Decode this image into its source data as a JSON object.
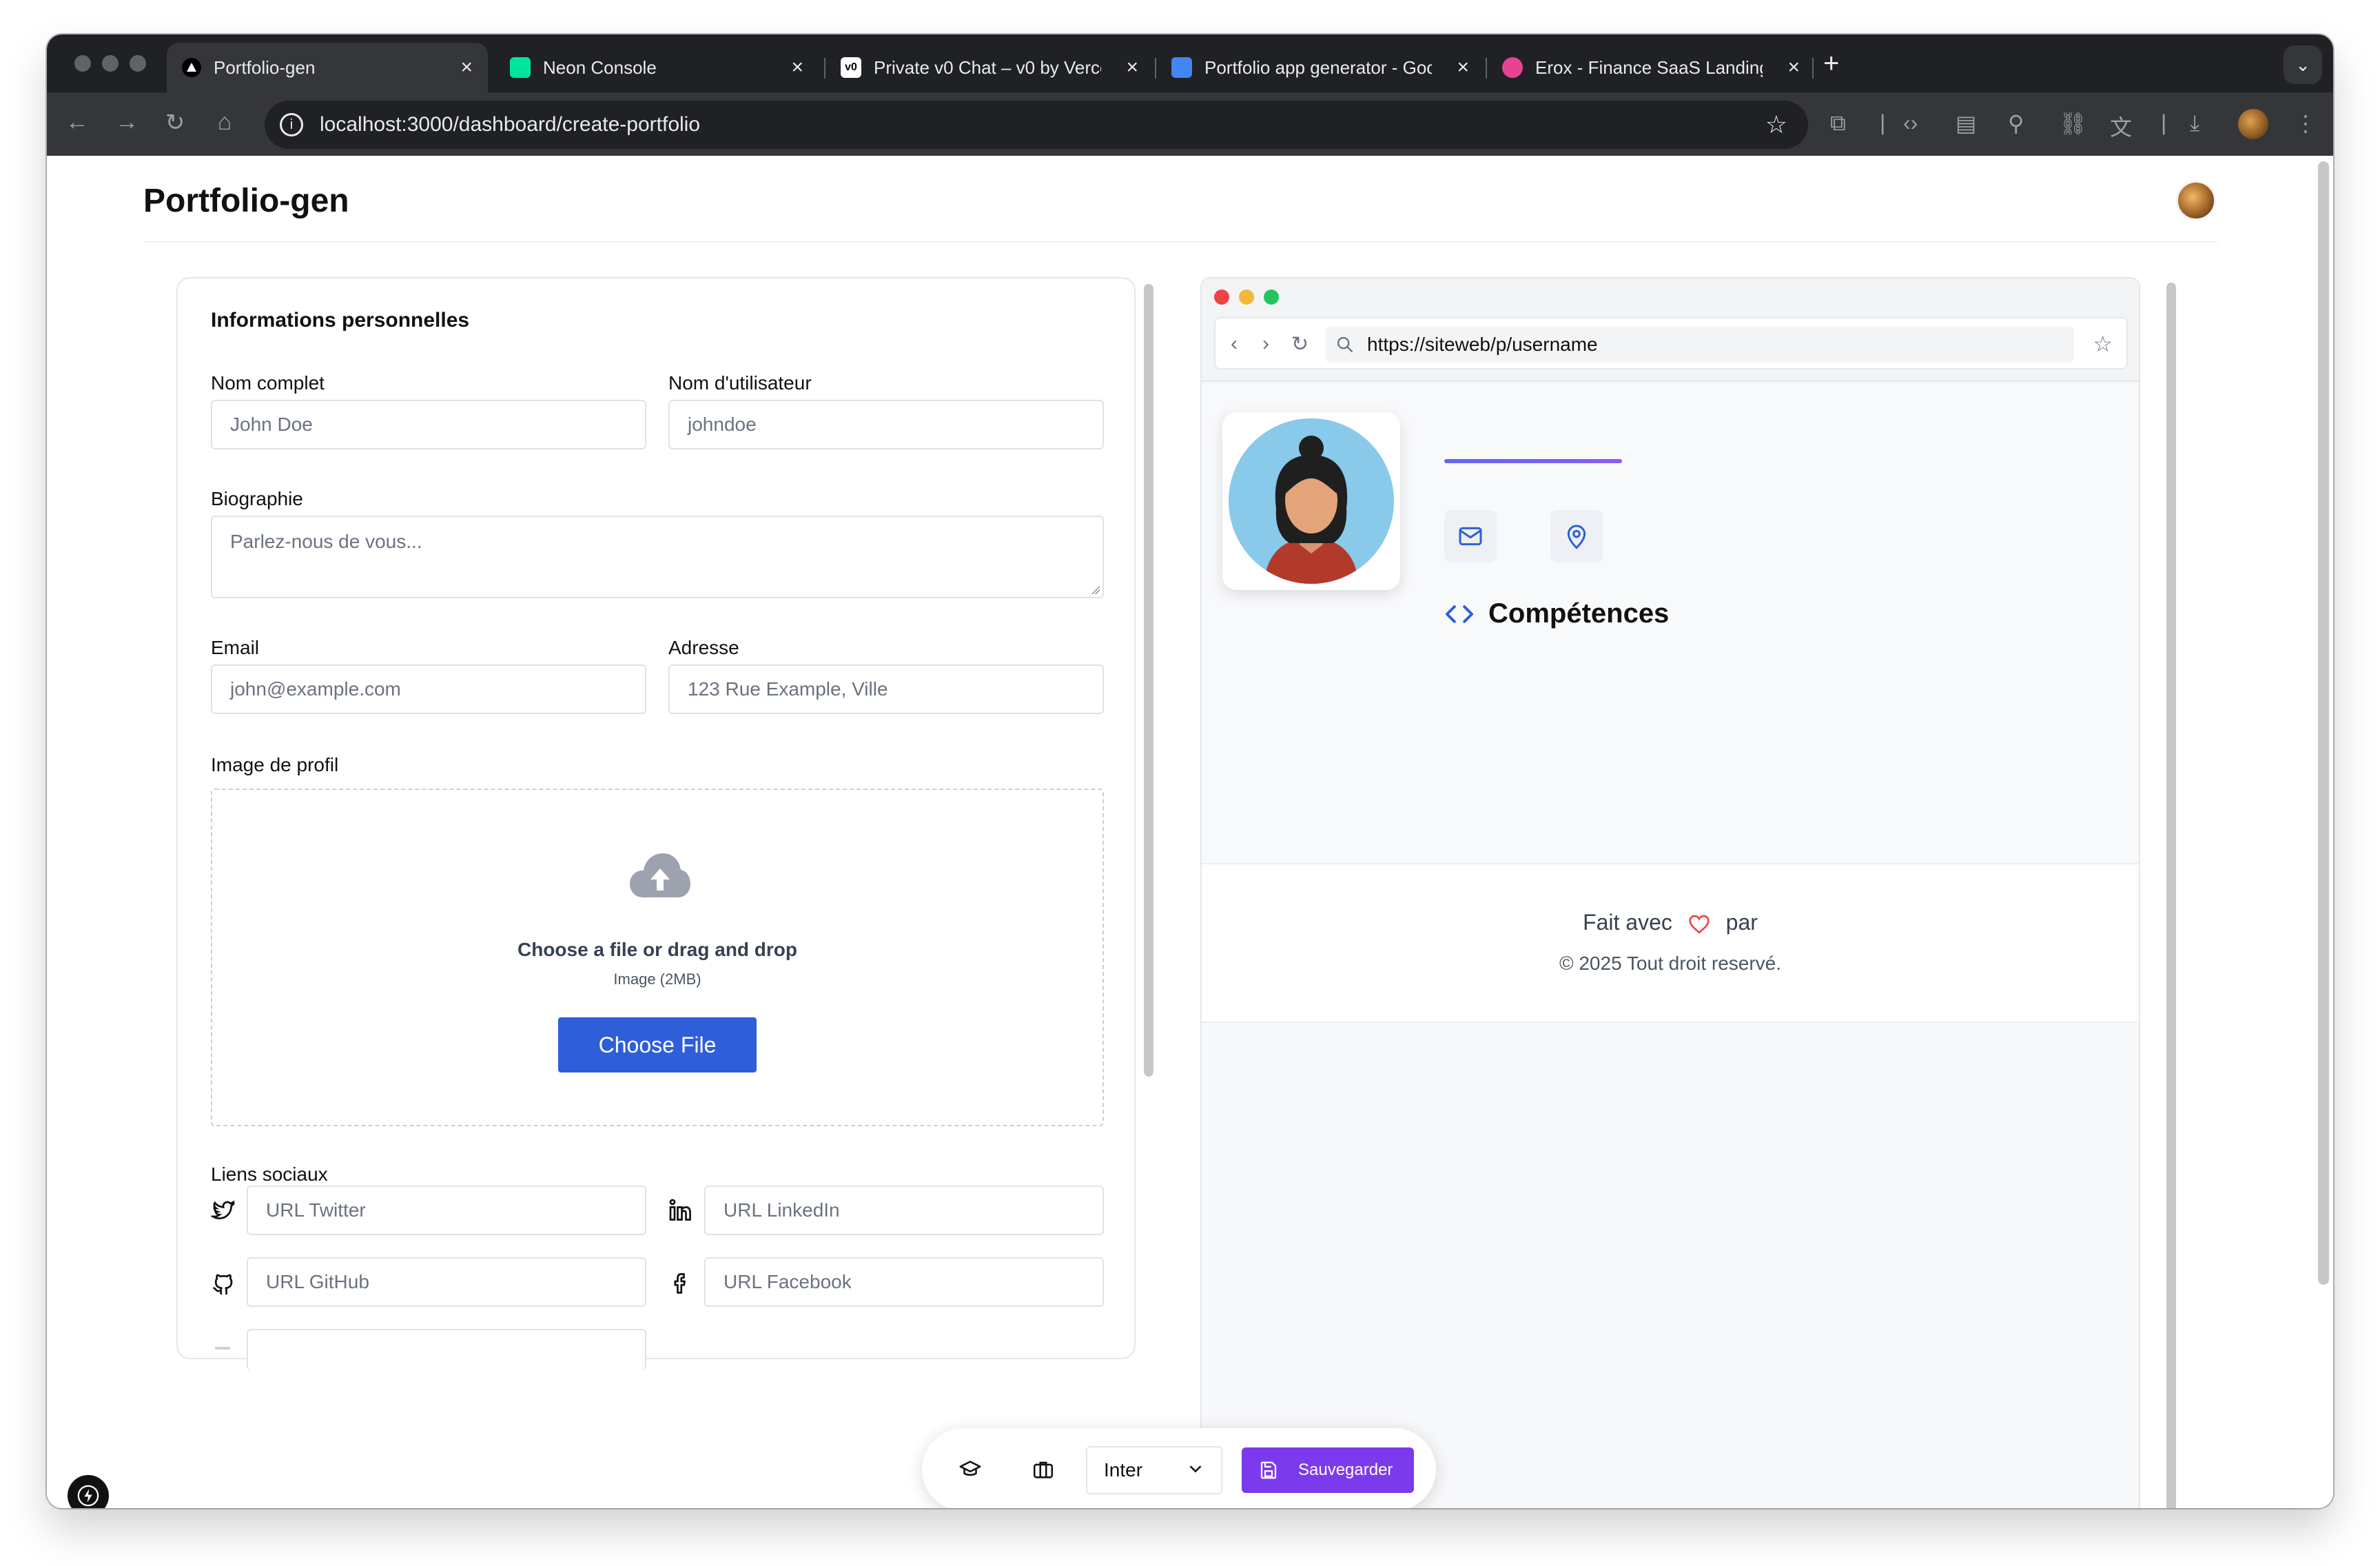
{
  "browser": {
    "tabs": [
      {
        "title": "Portfolio-gen",
        "active": true,
        "favicon_color": "#000000"
      },
      {
        "title": "Neon Console",
        "active": false,
        "favicon_color": "#00e599"
      },
      {
        "title": "Private v0 Chat – v0 by Verce",
        "active": false,
        "favicon_color": "#ffffff"
      },
      {
        "title": "Portfolio app generator - Goo",
        "active": false,
        "favicon_color": "#4285f4"
      },
      {
        "title": "Erox - Finance SaaS Landing",
        "active": false,
        "favicon_color": "#e84393"
      }
    ],
    "url": "localhost:3000/dashboard/create-portfolio"
  },
  "app": {
    "title": "Portfolio-gen"
  },
  "form": {
    "section_title": "Informations personnelles",
    "full_name": {
      "label": "Nom complet",
      "placeholder": "John Doe"
    },
    "username": {
      "label": "Nom d'utilisateur",
      "placeholder": "johndoe"
    },
    "bio": {
      "label": "Biographie",
      "placeholder": "Parlez-nous de vous..."
    },
    "email": {
      "label": "Email",
      "placeholder": "john@example.com"
    },
    "address": {
      "label": "Adresse",
      "placeholder": "123 Rue Example, Ville"
    },
    "profile_image": {
      "label": "Image de profil",
      "drop_text": "Choose a file or drag and drop",
      "sub_text": "Image (2MB)",
      "button_label": "Choose File"
    },
    "social": {
      "label": "Liens sociaux",
      "twitter": "URL Twitter",
      "linkedin": "URL LinkedIn",
      "github": "URL GitHub",
      "facebook": "URL Facebook"
    }
  },
  "preview": {
    "url": "https://siteweb/p/username",
    "skills_title": "Compétences",
    "footer_made_prefix": "Fait avec",
    "footer_made_suffix": "par",
    "footer_copyright": "© 2025 Tout droit reservé."
  },
  "bottom_toolbar": {
    "font_value": "Inter",
    "save_label": "Sauvegarder"
  },
  "colors": {
    "primary_blue": "#2f5fd8",
    "save_purple": "#7c3aed",
    "heart_red": "#ef4444"
  }
}
